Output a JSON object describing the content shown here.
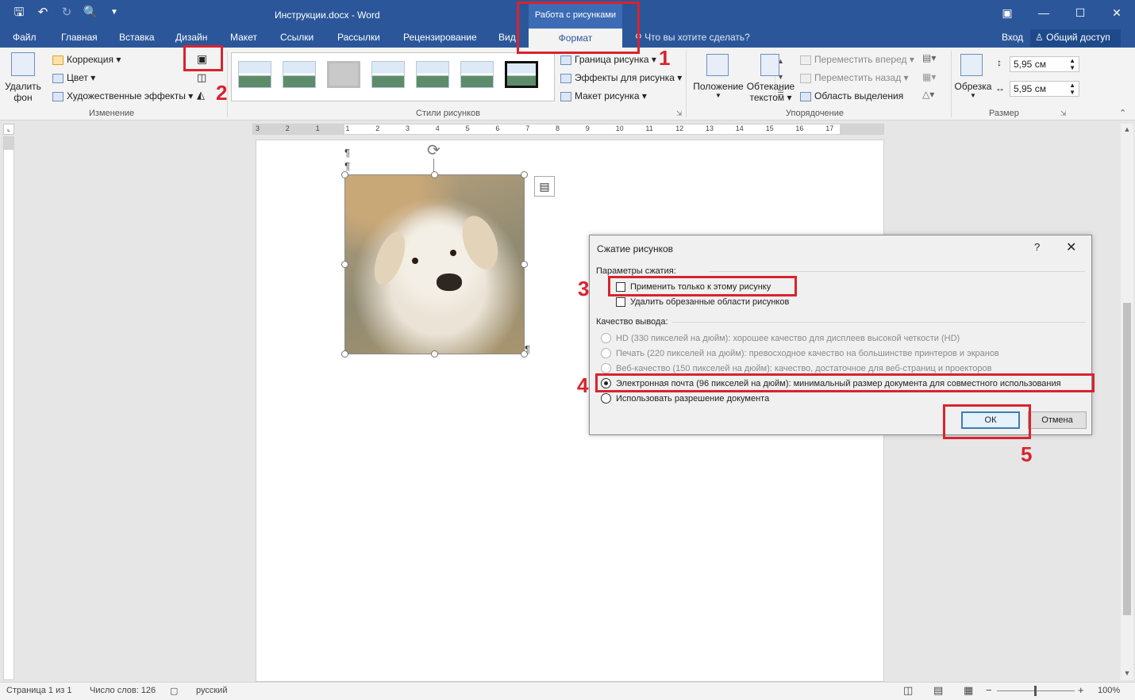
{
  "titlebar": {
    "doc_title": "Инструкции.docx - Word",
    "context_group": "Работа с рисунками"
  },
  "tabs": {
    "file": "Файл",
    "home": "Главная",
    "insert": "Вставка",
    "design": "Дизайн",
    "layout": "Макет",
    "references": "Ссылки",
    "mailings": "Рассылки",
    "review": "Рецензирование",
    "view": "Вид",
    "format": "Формат",
    "tell_me": "Что вы хотите сделать?",
    "login": "Вход",
    "share": "Общий доступ"
  },
  "ribbon": {
    "remove_bg_line1": "Удалить",
    "remove_bg_line2": "фон",
    "corrections": "Коррекция",
    "color": "Цвет",
    "artistic_effects": "Художественные эффекты",
    "group_adjust": "Изменение",
    "picture_border": "Граница рисунка",
    "picture_effects": "Эффекты для рисунка",
    "picture_layout": "Макет рисунка",
    "group_styles": "Стили рисунков",
    "position": "Положение",
    "wrap_line1": "Обтекание",
    "wrap_line2": "текстом",
    "bring_forward": "Переместить вперед",
    "send_backward": "Переместить назад",
    "selection_pane": "Область выделения",
    "group_arrange": "Упорядочение",
    "crop": "Обрезка",
    "height": "5,95 см",
    "width": "5,95 см",
    "group_size": "Размер"
  },
  "ruler": {
    "marks": [
      "3",
      "2",
      "1",
      "1",
      "2",
      "3",
      "4",
      "5",
      "6",
      "7",
      "8",
      "9",
      "10",
      "11",
      "12",
      "13",
      "14",
      "15",
      "16",
      "17"
    ]
  },
  "dialog": {
    "title": "Сжатие рисунков",
    "help": "?",
    "section_compression": "Параметры сжатия:",
    "apply_only_this": "Применить только к этому рисунку",
    "delete_cropped": "Удалить обрезанные области рисунков",
    "section_output": "Качество вывода:",
    "opt_hd": "HD (330 пикселей на дюйм): хорошее качество для дисплеев высокой четкости (HD)",
    "opt_print": "Печать (220 пикселей на дюйм): превосходное качество на большинстве принтеров и экранов",
    "opt_web": "Веб-качество (150 пикселей на дюйм): качество, достаточное для веб-страниц и проекторов",
    "opt_email": "Электронная почта (96 пикселей на дюйм): минимальный размер документа для совместного использования",
    "opt_doc": "Использовать разрешение документа",
    "ok": "ОК",
    "cancel": "Отмена",
    "selected_option": "email"
  },
  "annotations": {
    "n1": "1",
    "n2": "2",
    "n3": "3",
    "n4": "4",
    "n5": "5",
    "color": "#d9232e"
  },
  "statusbar": {
    "page": "Страница 1 из 1",
    "words": "Число слов: 126",
    "language": "русский",
    "zoom": "100%"
  },
  "colors": {
    "accent": "#2b579a",
    "ribbon_bg": "#f3f3f3"
  }
}
